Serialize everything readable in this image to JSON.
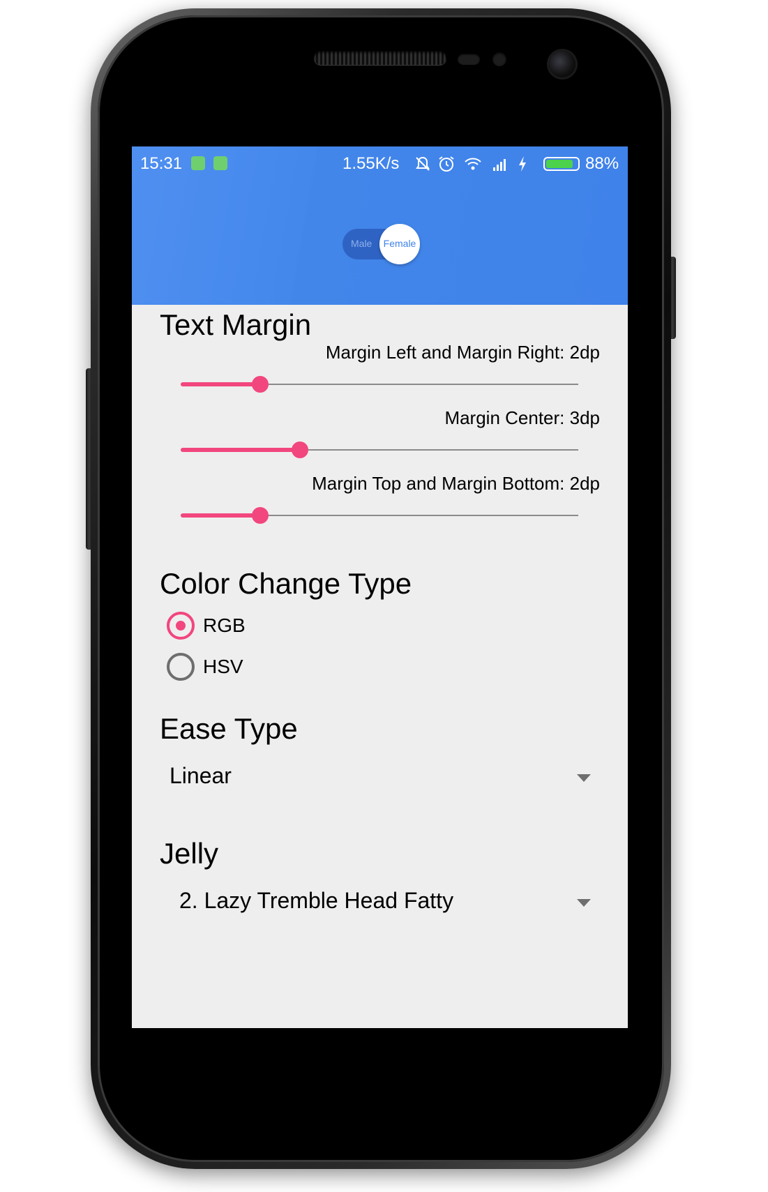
{
  "status_bar": {
    "time": "15:31",
    "speed": "1.55K/s",
    "battery_percent": "88%",
    "battery_level": 0.88,
    "icons": [
      "app-icon",
      "app-icon",
      "mute-icon",
      "alarm-icon",
      "wifi-icon",
      "signal-icon",
      "charging-icon",
      "battery-icon"
    ]
  },
  "toggle": {
    "left_label": "Male",
    "right_label": "Female",
    "selected": "Female"
  },
  "text_margin": {
    "title": "Text Margin",
    "sliders": [
      {
        "label": "Margin Left and Margin Right: 2dp",
        "fraction": 0.2
      },
      {
        "label": "Margin Center: 3dp",
        "fraction": 0.3
      },
      {
        "label": "Margin Top and Margin Bottom: 2dp",
        "fraction": 0.2
      }
    ]
  },
  "color_change": {
    "title": "Color Change Type",
    "options": [
      {
        "label": "RGB",
        "checked": true
      },
      {
        "label": "HSV",
        "checked": false
      }
    ]
  },
  "ease_type": {
    "title": "Ease Type",
    "value": "Linear"
  },
  "jelly": {
    "title": "Jelly",
    "value": "2. Lazy Tremble Head Fatty"
  },
  "colors": {
    "app_bar": "#3f82e9",
    "accent": "#f2467e",
    "background": "#eeeeee"
  }
}
